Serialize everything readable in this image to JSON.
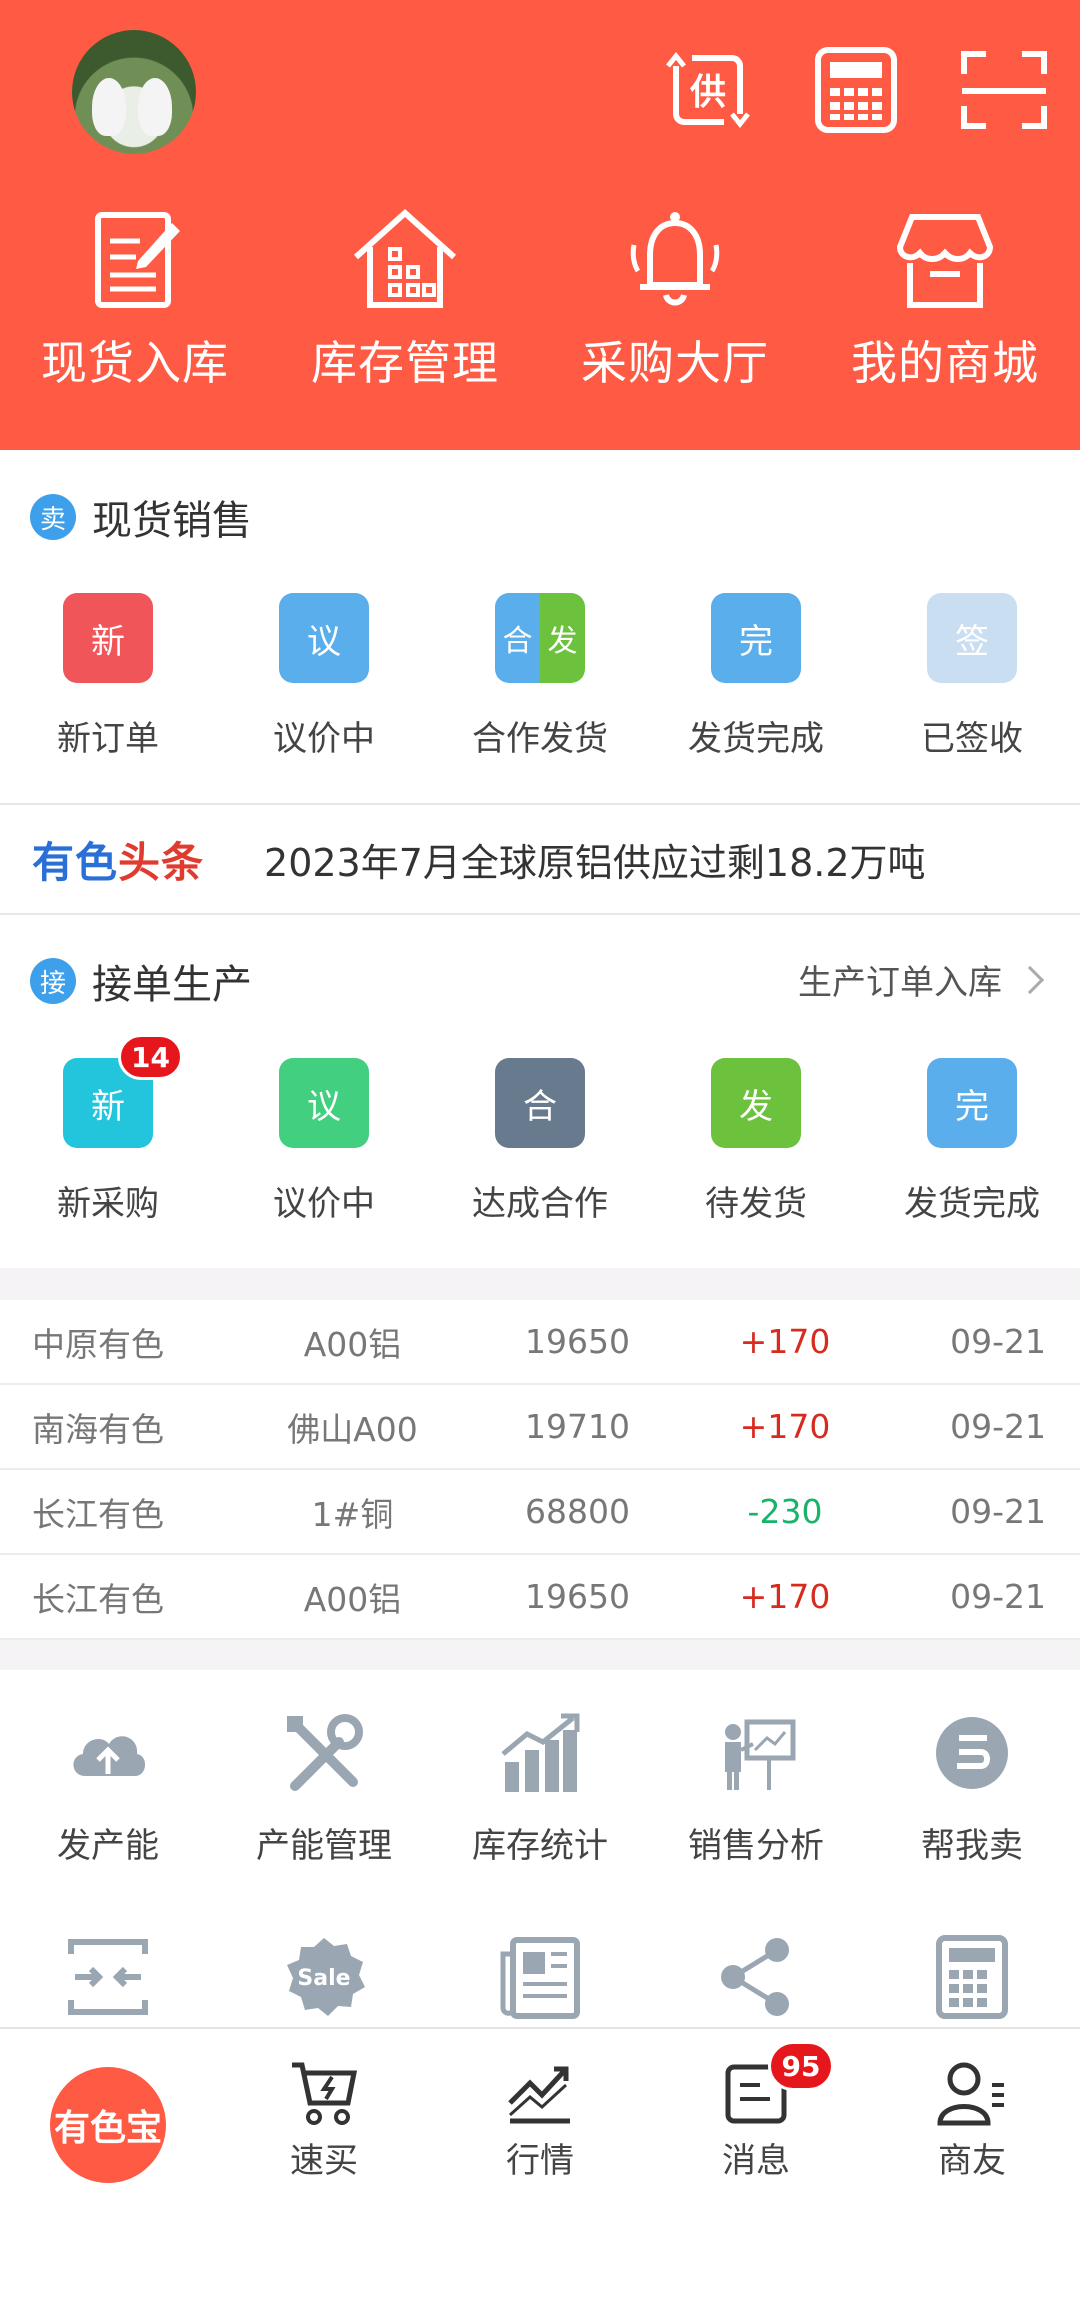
{
  "header": {
    "icons": [
      "supply-switch-icon",
      "calculator-icon",
      "scan-icon"
    ],
    "supply_glyph": "供",
    "quick": [
      {
        "label": "现货入库",
        "icon": "edit-note-icon"
      },
      {
        "label": "库存管理",
        "icon": "warehouse-icon"
      },
      {
        "label": "采购大厅",
        "icon": "bell-icon"
      },
      {
        "label": "我的商城",
        "icon": "store-icon"
      }
    ]
  },
  "spot_sales": {
    "badge": "卖",
    "title": "现货销售",
    "items": [
      {
        "glyph": "新",
        "label": "新订单",
        "color": "#f0555a"
      },
      {
        "glyph": "议",
        "label": "议价中",
        "color": "#5aaeec"
      },
      {
        "glyph_a": "合",
        "glyph_b": "发",
        "label": "合作发货",
        "color_a": "#5aaeec",
        "color_b": "#6cc13d"
      },
      {
        "glyph": "完",
        "label": "发货完成",
        "color": "#5aaeec"
      },
      {
        "glyph": "签",
        "label": "已签收",
        "color": "#c9def1"
      }
    ]
  },
  "headline": {
    "brand_part1": "有色",
    "brand_part2": "头条",
    "text": "2023年7月全球原铝供应过剩18.2万吨"
  },
  "production": {
    "badge": "接",
    "title": "接单生产",
    "link": "生产订单入库",
    "items": [
      {
        "glyph": "新",
        "label": "新采购",
        "color": "#22c5dc",
        "badge": "14"
      },
      {
        "glyph": "议",
        "label": "议价中",
        "color": "#43cf80"
      },
      {
        "glyph": "合",
        "label": "达成合作",
        "color": "#677a8e"
      },
      {
        "glyph": "发",
        "label": "待发货",
        "color": "#6cc13d"
      },
      {
        "glyph": "完",
        "label": "发货完成",
        "color": "#5aaeec"
      }
    ]
  },
  "prices": [
    {
      "market": "中原有色",
      "product": "A00铝",
      "price": "19650",
      "change": "+170",
      "date": "09-21",
      "dir": "up"
    },
    {
      "market": "南海有色",
      "product": "佛山A00",
      "price": "19710",
      "change": "+170",
      "date": "09-21",
      "dir": "up"
    },
    {
      "market": "长江有色",
      "product": "1#铜",
      "price": "68800",
      "change": "-230",
      "date": "09-21",
      "dir": "down"
    },
    {
      "market": "长江有色",
      "product": "A00铝",
      "price": "19650",
      "change": "+170",
      "date": "09-21",
      "dir": "up"
    }
  ],
  "tools_row1": [
    {
      "label": "发产能",
      "icon": "cloud-upload-icon"
    },
    {
      "label": "产能管理",
      "icon": "tools-icon"
    },
    {
      "label": "库存统计",
      "icon": "bar-growth-icon"
    },
    {
      "label": "销售分析",
      "icon": "presentation-icon"
    },
    {
      "label": "帮我卖",
      "icon": "sell-helper-icon"
    }
  ],
  "tools_row2": [
    {
      "icon": "merge-arrows-icon"
    },
    {
      "icon": "sale-tag-icon",
      "text": "Sale"
    },
    {
      "icon": "newspaper-icon"
    },
    {
      "icon": "share-icon"
    },
    {
      "icon": "calculator-icon"
    }
  ],
  "nav": {
    "home": "有色宝",
    "items": [
      {
        "label": "速买",
        "icon": "quick-buy-cart-icon"
      },
      {
        "label": "行情",
        "icon": "market-trend-icon"
      },
      {
        "label": "消息",
        "icon": "message-icon",
        "badge": "95"
      },
      {
        "label": "商友",
        "icon": "contacts-icon"
      }
    ]
  },
  "colors": {
    "brand": "#ff5a44",
    "up": "#d72b1f",
    "down": "#19b26b",
    "section_badge": "#3ea0ea",
    "tool_icon": "#9aa6b2"
  }
}
